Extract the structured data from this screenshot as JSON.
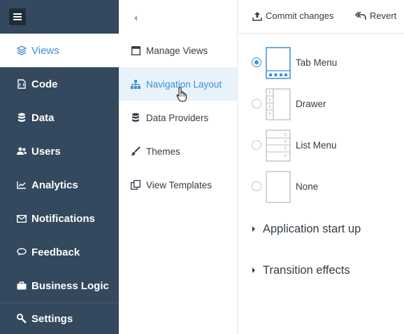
{
  "sidebar": {
    "menu_icon": "hamburger-icon",
    "items": [
      {
        "label": "Views",
        "icon": "layers-icon"
      },
      {
        "label": "Code",
        "icon": "code-file-icon"
      },
      {
        "label": "Data",
        "icon": "database-icon"
      },
      {
        "label": "Users",
        "icon": "users-icon"
      },
      {
        "label": "Analytics",
        "icon": "line-chart-icon"
      },
      {
        "label": "Notifications",
        "icon": "envelope-icon"
      },
      {
        "label": "Feedback",
        "icon": "chat-icon"
      },
      {
        "label": "Business Logic",
        "icon": "briefcase-icon"
      },
      {
        "label": "Settings",
        "icon": "wrench-icon"
      }
    ],
    "active_index": 0
  },
  "subnav": {
    "collapse_icon": "chevron-left-icon",
    "items": [
      {
        "label": "Manage Views",
        "icon": "layout-icon"
      },
      {
        "label": "Navigation Layout",
        "icon": "sitemap-icon"
      },
      {
        "label": "Data Providers",
        "icon": "database-icon"
      },
      {
        "label": "Themes",
        "icon": "brush-icon"
      },
      {
        "label": "View Templates",
        "icon": "templates-icon"
      }
    ],
    "active_index": 1
  },
  "toolbar": {
    "commit_label": "Commit changes",
    "revert_label": "Revert"
  },
  "layout_options": [
    {
      "label": "Tab Menu",
      "selected": true
    },
    {
      "label": "Drawer",
      "selected": false
    },
    {
      "label": "List Menu",
      "selected": false
    },
    {
      "label": "None",
      "selected": false
    }
  ],
  "sections": [
    {
      "title": "Application start up"
    },
    {
      "title": "Transition effects"
    }
  ],
  "colors": {
    "sidebar_bg": "#34495e",
    "accent": "#3d8fd4",
    "subnav_active_bg": "#e8f2fb",
    "text": "#333d47"
  }
}
